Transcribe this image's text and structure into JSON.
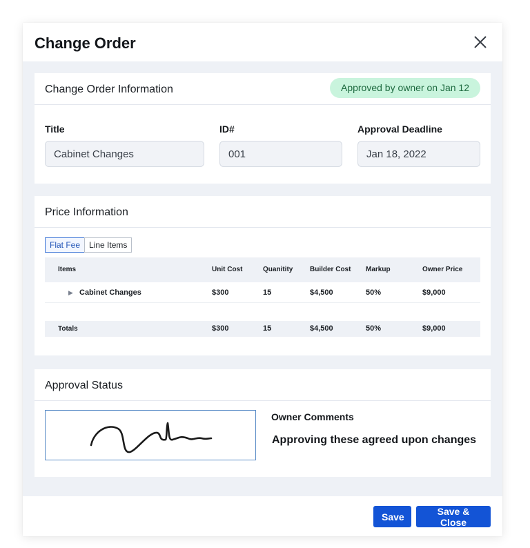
{
  "dialog": {
    "title": "Change Order",
    "close_icon": "close-icon"
  },
  "info": {
    "title": "Change Order Information",
    "status": "Approved by owner on Jan 12",
    "status_color": "#c9f4dd",
    "fields": {
      "title_label": "Title",
      "title_value": "Cabinet Changes",
      "id_label": "ID#",
      "id_value": "001",
      "deadline_label": "Approval Deadline",
      "deadline_value": "Jan 18, 2022"
    }
  },
  "price": {
    "title": "Price Information",
    "tabs": [
      "Flat Fee",
      "Line Items"
    ],
    "active_tab": "Flat Fee",
    "columns": [
      "Items",
      "Unit Cost",
      "Quanitity",
      "Builder Cost",
      "Markup",
      "Owner Price"
    ],
    "rows": [
      {
        "item": "Cabinet Changes",
        "unit_cost": "$300",
        "quantity": "15",
        "builder_cost": "$4,500",
        "markup": "50%",
        "owner_price": "$9,000",
        "icon": "expand-caret-icon"
      }
    ],
    "totals": {
      "label": "Totals",
      "unit_cost": "$300",
      "quantity": "15",
      "builder_cost": "$4,500",
      "markup": "50%",
      "owner_price": "$9,000"
    }
  },
  "approval": {
    "title": "Approval Status",
    "comments_label": "Owner Comments",
    "comments_text": "Approving these agreed upon changes"
  },
  "footer": {
    "save_label": "Save",
    "save_close_label": "Save & Close",
    "button_color": "#1354d6"
  }
}
